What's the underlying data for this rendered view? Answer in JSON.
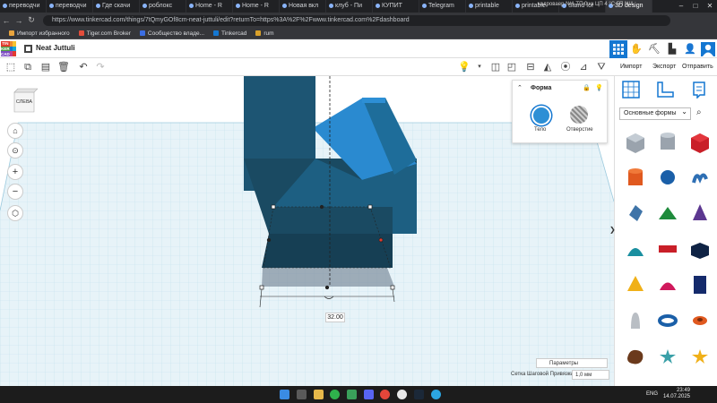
{
  "browser": {
    "tabs": [
      {
        "title": "переводчи"
      },
      {
        "title": "переводчи"
      },
      {
        "title": "Где скачи"
      },
      {
        "title": "роблокс"
      },
      {
        "title": "Home - R"
      },
      {
        "title": "Home - R"
      },
      {
        "title": "Новая вкл"
      },
      {
        "title": "клуб - Пи"
      },
      {
        "title": "КУПИТ"
      },
      {
        "title": "Telegram"
      },
      {
        "title": "printable"
      },
      {
        "title": "printable"
      },
      {
        "title": "Stand for"
      },
      {
        "title": "3D design"
      }
    ],
    "url": "https://www.tinkercad.com/things/7tQmyGOf8cm-neat-juttuli/edit?returnTo=https%3A%2F%2Fwww.tinkercad.com%2Fdashboard",
    "bookmarks": [
      "Импорт избранного",
      "Tiger.com Broker",
      "Сообщество владе...",
      "Tinkercad",
      "rum"
    ],
    "tray_overlay": "кадроваер  N/A   ТП  0 кк   ЦП  4 °C   ГП  N/A"
  },
  "app": {
    "logo_letters": [
      "TIN",
      "KER",
      "CAD"
    ],
    "design_title": "Neat Juttuli",
    "buttons": {
      "import": "Импорт",
      "export": "Экспорт",
      "send": "Отправить"
    }
  },
  "viewcube": {
    "label": "СЛЕВА"
  },
  "shape_panel": {
    "title": "Форма",
    "solid": "Тело",
    "hole": "Отверстие"
  },
  "dimension": {
    "value": "32.00"
  },
  "settings": {
    "params": "Параметры",
    "snap_label": "Сетка Шаговой Привязки",
    "snap_value": "1,0 мм"
  },
  "library": {
    "category": "Основные формы",
    "shapes": [
      "box-striped",
      "cylinder-striped",
      "red-box",
      "orange-cylinder",
      "blue-sphere",
      "blue-scribble",
      "blue-gem",
      "green-roof",
      "purple-cone",
      "teal-half-round",
      "red-text",
      "navy-box",
      "yellow-pyramid",
      "magenta-hemisphere",
      "navy-box-tall",
      "grey-paraboloid",
      "blue-torus",
      "orange-tube",
      "brown-blob",
      "teal-star",
      "yellow-star"
    ]
  },
  "taskbar": {
    "lang": "ENG",
    "time": "23:49",
    "date": "14.07.2025"
  },
  "colors": {
    "accent": "#1477d1",
    "object": "#2d8fd5",
    "object_dark": "#1d5573",
    "grid_line": "#b9dbe9"
  }
}
